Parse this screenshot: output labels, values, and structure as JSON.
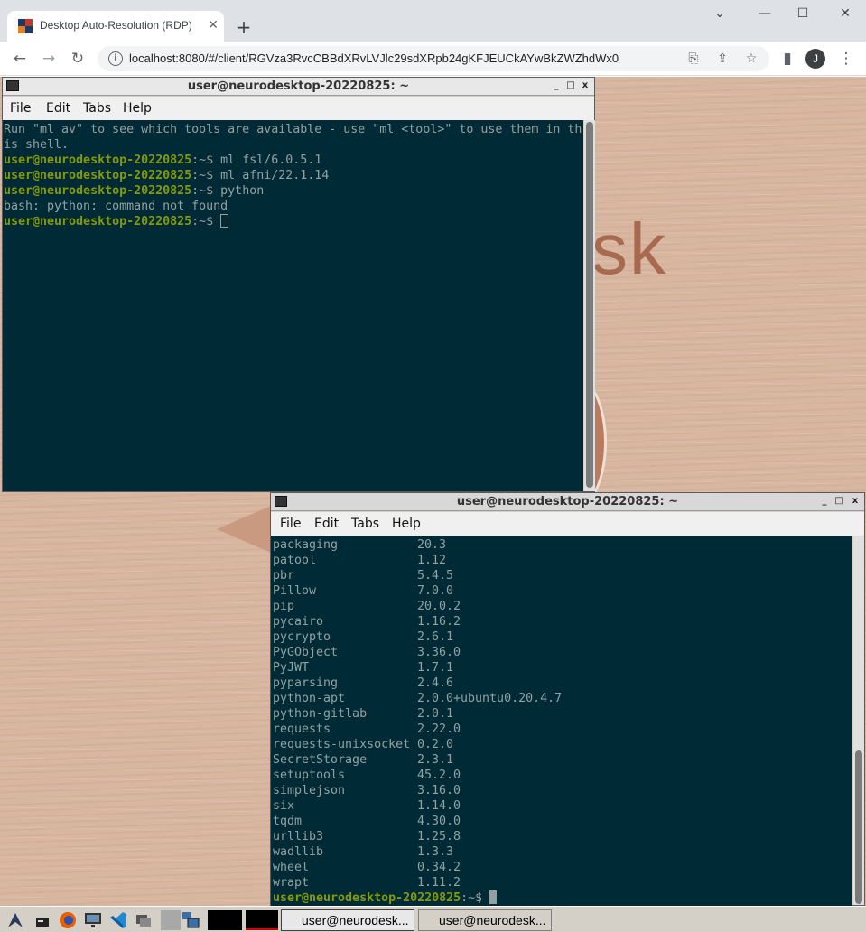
{
  "browser": {
    "tab_title": "Desktop Auto-Resolution (RDP)",
    "tab_close": "✕",
    "new_tab": "+",
    "url": "localhost:8080/#/client/RGVza3RvcCBBdXRvLVJlc29sdXRpb24gKFJEUCkAYwBkZWZhdWx0",
    "profile_initial": "J",
    "window_controls": {
      "minimize": "⌄",
      "minimize2": "—",
      "maximize": "☐",
      "close": "✕"
    },
    "nav": {
      "back": "←",
      "forward": "→",
      "reload": "↻",
      "menu": "⋮"
    },
    "omnibox_icons": {
      "clipboard": "⎘",
      "share": "⇪",
      "bookmark": "☆",
      "sidebar": "▮"
    }
  },
  "wallpaper": {
    "logo_text": "sk"
  },
  "terminal_top": {
    "title": "user@neurodesktop-20220825: ~",
    "controls": {
      "minimize": "_",
      "maximize": "□",
      "close": "x"
    },
    "menu": [
      "File",
      "Edit",
      "Tabs",
      "Help"
    ],
    "intro_line_1": "Run \"ml av\" to see which tools are available - use \"ml <tool>\" to use them in th",
    "intro_line_2": "is shell.",
    "prompt_user": "user@neurodesktop-20220825",
    "prompt_path": ":~$ ",
    "commands": [
      "ml fsl/6.0.5.1",
      "ml afni/22.1.14",
      "python"
    ],
    "error_line": "bash: python: command not found"
  },
  "terminal_bottom": {
    "title": "user@neurodesktop-20220825: ~",
    "controls": {
      "minimize": "_",
      "maximize": "□",
      "close": "x"
    },
    "menu": [
      "File",
      "Edit",
      "Tabs",
      "Help"
    ],
    "packages": [
      {
        "name": "packaging",
        "version": "20.3"
      },
      {
        "name": "patool",
        "version": "1.12"
      },
      {
        "name": "pbr",
        "version": "5.4.5"
      },
      {
        "name": "Pillow",
        "version": "7.0.0"
      },
      {
        "name": "pip",
        "version": "20.0.2"
      },
      {
        "name": "pycairo",
        "version": "1.16.2"
      },
      {
        "name": "pycrypto",
        "version": "2.6.1"
      },
      {
        "name": "PyGObject",
        "version": "3.36.0"
      },
      {
        "name": "PyJWT",
        "version": "1.7.1"
      },
      {
        "name": "pyparsing",
        "version": "2.4.6"
      },
      {
        "name": "python-apt",
        "version": "2.0.0+ubuntu0.20.4.7"
      },
      {
        "name": "python-gitlab",
        "version": "2.0.1"
      },
      {
        "name": "requests",
        "version": "2.22.0"
      },
      {
        "name": "requests-unixsocket",
        "version": "0.2.0"
      },
      {
        "name": "SecretStorage",
        "version": "2.3.1"
      },
      {
        "name": "setuptools",
        "version": "45.2.0"
      },
      {
        "name": "simplejson",
        "version": "3.16.0"
      },
      {
        "name": "six",
        "version": "1.14.0"
      },
      {
        "name": "tqdm",
        "version": "4.30.0"
      },
      {
        "name": "urllib3",
        "version": "1.25.8"
      },
      {
        "name": "wadllib",
        "version": "1.3.3"
      },
      {
        "name": "wheel",
        "version": "0.34.2"
      },
      {
        "name": "wrapt",
        "version": "1.11.2"
      }
    ],
    "prompt_user": "user@neurodesktop-20220825",
    "prompt_path": ":~$ "
  },
  "taskbar": {
    "tasks": [
      "user@neurodesk...",
      "user@neurodesk..."
    ]
  },
  "colors": {
    "terminal_bg": "#002b36",
    "terminal_fg": "#93a1a1",
    "prompt_green": "#859900"
  }
}
